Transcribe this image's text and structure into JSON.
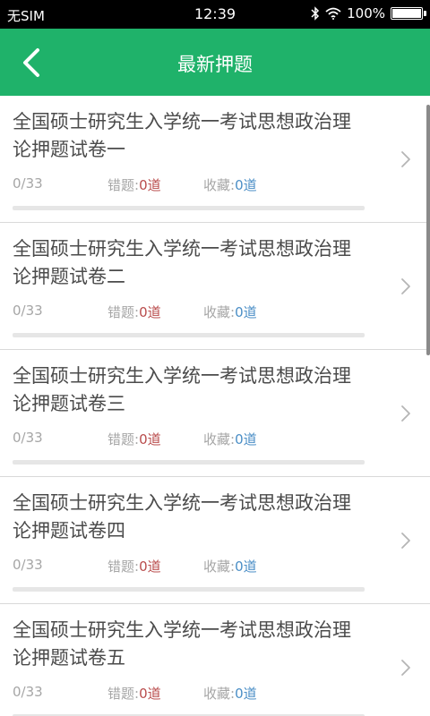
{
  "status_bar": {
    "carrier": "无SIM",
    "time": "12:39",
    "battery": "100%",
    "icons": [
      "bluetooth-icon",
      "wifi-icon",
      "battery-icon"
    ]
  },
  "header": {
    "title": "最新押题",
    "back_icon": "chevron-left-icon"
  },
  "colors": {
    "accent": "#1fb26a",
    "wrong_count": "#b94c4c",
    "favorite_count": "#4a8ec6"
  },
  "labels": {
    "wrong": "错题:",
    "favorite": "收藏:"
  },
  "papers": [
    {
      "title": "全国硕士研究生入学统一考试思想政治理论押题试卷一",
      "progress": "0/33",
      "wrong": "0道",
      "favorite": "0道",
      "progress_fraction": 0
    },
    {
      "title": "全国硕士研究生入学统一考试思想政治理论押题试卷二",
      "progress": "0/33",
      "wrong": "0道",
      "favorite": "0道",
      "progress_fraction": 0
    },
    {
      "title": "全国硕士研究生入学统一考试思想政治理论押题试卷三",
      "progress": "0/33",
      "wrong": "0道",
      "favorite": "0道",
      "progress_fraction": 0
    },
    {
      "title": "全国硕士研究生入学统一考试思想政治理论押题试卷四",
      "progress": "0/33",
      "wrong": "0道",
      "favorite": "0道",
      "progress_fraction": 0
    },
    {
      "title": "全国硕士研究生入学统一考试思想政治理论押题试卷五",
      "progress": "0/33",
      "wrong": "0道",
      "favorite": "0道",
      "progress_fraction": 0
    }
  ]
}
